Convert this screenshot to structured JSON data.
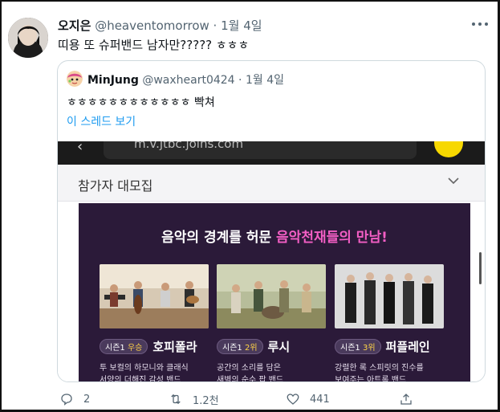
{
  "tweet": {
    "author_name": "오지은",
    "handle": "@heaventomorrow",
    "separator": "·",
    "date": "1월 4일",
    "text": "띠용 또 슈퍼밴드 남자만????? ㅎㅎㅎ",
    "avatar_icon": "user-avatar",
    "more_icon": "more-icon"
  },
  "quote": {
    "author_name": "MinJung",
    "handle": "@waxheart0424",
    "separator": "·",
    "date": "1월 4일",
    "text": "ㅎㅎㅎㅎㅎㅎㅎㅎㅎㅎㅎㅎ 빡쳐",
    "thread_link": "이 스레드 보기",
    "link_color": "#1d9bf0"
  },
  "embedded": {
    "url_text": "m.v.jtbc.joins.com",
    "section_label": "참가자 대모집",
    "banner_title_white": "음악의 경계를 허문 ",
    "banner_title_pink": "음악천재들의 만남!",
    "banner_bg": "#2b1a39",
    "accent_pink": "#f25ec4",
    "cards": [
      {
        "season": "시즌1",
        "rank": "우승",
        "team": "호피폴라",
        "desc1": "투 보컬의 하모니와 클래식",
        "desc2": "서양의 더해진 감성 밴드"
      },
      {
        "season": "시즌1",
        "rank": "2위",
        "team": "루시",
        "desc1": "공간의 소리를 담은",
        "desc2": "새벽의 순수 팝 밴드"
      },
      {
        "season": "시즌1",
        "rank": "3위",
        "team": "퍼플레인",
        "desc1": "강렬한 록 스피릿의 진수를",
        "desc2": "보여주는 아트록 밴드"
      }
    ]
  },
  "actions": {
    "reply_count": "2",
    "retweet_count": "1.2천",
    "like_count": "441",
    "icons": [
      "reply-icon",
      "retweet-icon",
      "like-icon",
      "share-icon"
    ],
    "icon_color": "#536471"
  }
}
